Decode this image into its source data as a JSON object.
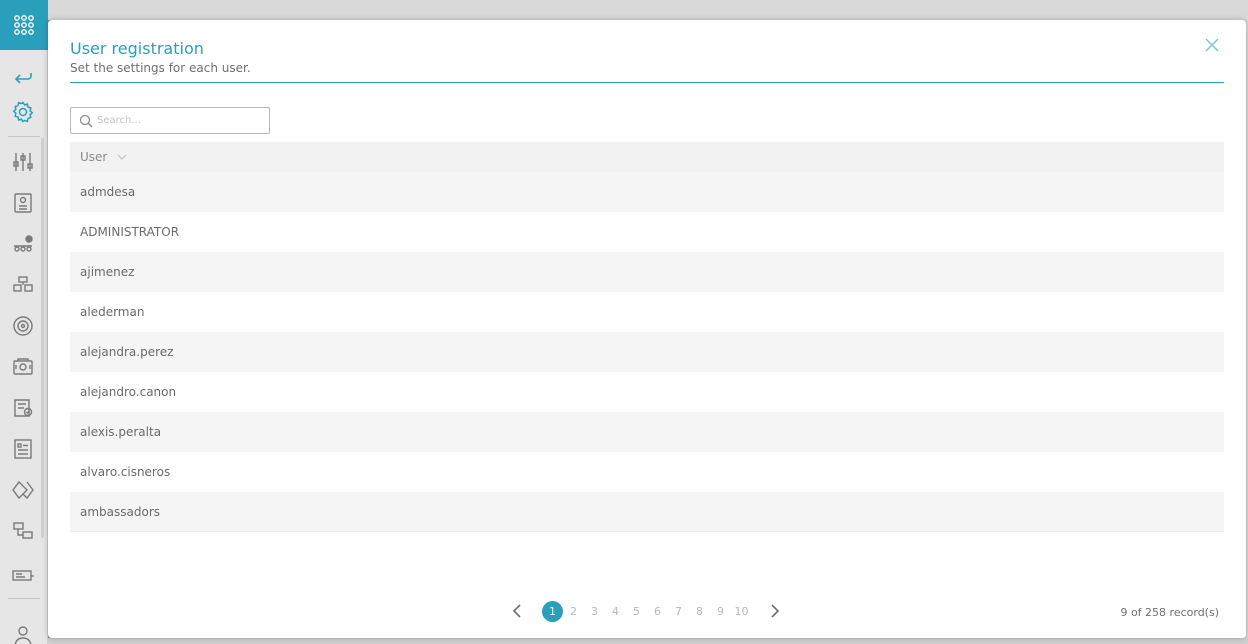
{
  "modal": {
    "title": "User registration",
    "subtitle": "Set the settings for each user."
  },
  "search": {
    "placeholder": "Search..."
  },
  "table": {
    "column_user": "User",
    "rows": [
      "admdesa",
      "ADMINISTRATOR",
      "ajimenez",
      "alederman",
      "alejandra.perez",
      "alejandro.canon",
      "alexis.peralta",
      "alvaro.cisneros",
      "ambassadors"
    ]
  },
  "pagination": {
    "pages": [
      "1",
      "2",
      "3",
      "4",
      "5",
      "6",
      "7",
      "8",
      "9",
      "10"
    ],
    "current": 1,
    "records_label": "9 of 258 record(s)"
  },
  "colors": {
    "accent": "#2a9fbc",
    "row_alt": "#f5f5f5"
  },
  "icons": {
    "sidebar": [
      "apps-grid-icon",
      "back-arrow-icon",
      "settings-gear-icon",
      "sliders-icon",
      "id-card-icon",
      "group-icon",
      "network-icon",
      "target-icon",
      "server-icon",
      "report-check-icon",
      "form-list-icon",
      "diamond-icon",
      "devices-icon",
      "keyboard-icon",
      "user-icon"
    ],
    "modal": [
      "close-icon",
      "search-icon",
      "chevron-down-icon",
      "chevron-left-icon",
      "chevron-right-icon"
    ]
  }
}
